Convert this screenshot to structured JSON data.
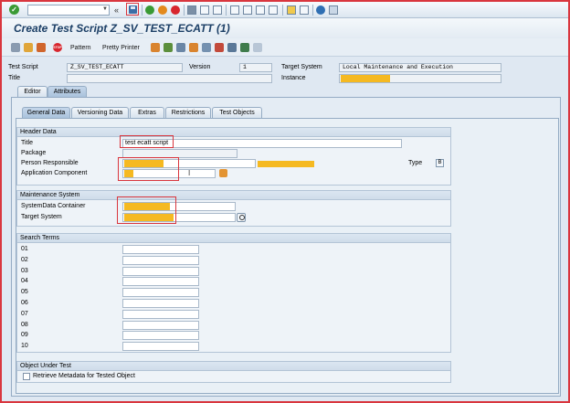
{
  "toolbar": {
    "ok_glyph": "✓",
    "history_glyph": "«",
    "save_icon": "save-icon"
  },
  "title": "Create Test Script Z_SV_TEST_ECATT (1)",
  "app_toolbar": {
    "pattern_label": "Pattern",
    "pretty_printer_label": "Pretty Printer"
  },
  "header": {
    "test_script_label": "Test Script",
    "test_script_value": "Z_SV_TEST_ECATT",
    "version_label": "Version",
    "version_value": "1",
    "target_system_label": "Target System",
    "target_system_value": "Local Maintenance and Execution",
    "title_label": "Title",
    "instance_label": "Instance"
  },
  "main_tabs": [
    "Editor",
    "Attributes"
  ],
  "sub_tabs": [
    "General Data",
    "Versioning Data",
    "Extras",
    "Restrictions",
    "Test Objects"
  ],
  "header_data": {
    "heading": "Header Data",
    "title_label": "Title",
    "title_value": "test ecatt script",
    "package_label": "Package",
    "person_label": "Person Responsible",
    "app_component_label": "Application Component",
    "type_label": "Type",
    "type_value": "B"
  },
  "maintenance": {
    "heading": "Maintenance System",
    "sdc_label": "SystemData Container",
    "target_label": "Target System"
  },
  "search_terms": {
    "heading": "Search Terms",
    "rows": [
      "01",
      "02",
      "03",
      "04",
      "05",
      "06",
      "07",
      "08",
      "09",
      "10"
    ]
  },
  "object_under_test": {
    "heading": "Object Under Test",
    "retrieve_label": "Retrieve Metadata for Tested Object"
  },
  "colors": {
    "redacted": "#f5b921",
    "highlight": "#d9363e",
    "accent": "#1c3f66"
  }
}
